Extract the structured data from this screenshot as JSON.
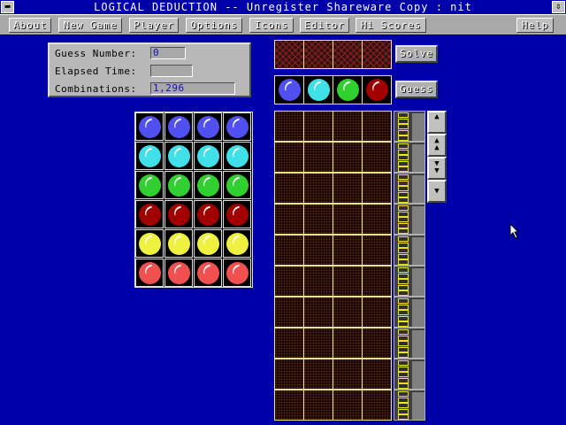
{
  "window": {
    "title": "LOGICAL DEDUCTION -- Unregister Shareware Copy : nit",
    "system_menu_glyph": "▬",
    "restore_glyph": "⇕"
  },
  "menu": [
    {
      "label": "About"
    },
    {
      "label": "New Game"
    },
    {
      "label": "Player"
    },
    {
      "label": "Options"
    },
    {
      "label": "Icons"
    },
    {
      "label": "Editor"
    },
    {
      "label": "Hi Scores"
    },
    {
      "label": "Help"
    }
  ],
  "info": {
    "guess_number_label": "Guess Number:",
    "guess_number_value": "0",
    "elapsed_time_label": "Elapsed Time:",
    "elapsed_time_value": "",
    "combinations_label": "Combinations:",
    "combinations_value": "1,296"
  },
  "palette_colors": [
    {
      "name": "blue",
      "color": "#5050f0"
    },
    {
      "name": "cyan",
      "color": "#40e0e8"
    },
    {
      "name": "green",
      "color": "#30d030"
    },
    {
      "name": "dark-red",
      "color": "#a00000"
    },
    {
      "name": "yellow",
      "color": "#f0f040"
    },
    {
      "name": "light-red",
      "color": "#f05050"
    }
  ],
  "current_guess": [
    "blue",
    "cyan",
    "green",
    "dark-red"
  ],
  "buttons": {
    "solve": "Solve",
    "guess": "Guess"
  },
  "scroll": {
    "top": "▲",
    "page_up": "▲▲",
    "page_down": "▼▼",
    "bottom": "▼"
  },
  "board": {
    "rows": 10,
    "columns": 4,
    "pegs_per_score": 5
  }
}
